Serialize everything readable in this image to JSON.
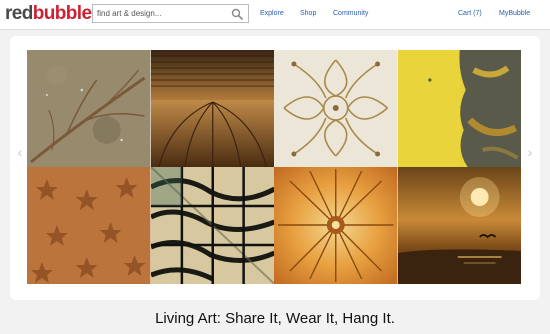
{
  "header": {
    "logo_part1": "red",
    "logo_part2": "bubble",
    "search_placeholder": "find art & design...",
    "nav": {
      "explore": "Explore",
      "shop": "Shop",
      "community": "Community",
      "cart": "Cart (7)",
      "my_bubble": "MyBubble"
    }
  },
  "slideshow": {
    "prev_icon": "chevron-left-icon",
    "next_icon": "chevron-right-icon",
    "artworks": [
      "leaf-skeleton-on-sand",
      "bronze-ribbed-metal",
      "kaleidoscope-pattern",
      "yellow-paint-texture",
      "starfish-pattern",
      "zebra-pattern-squares",
      "golden-fractal-burst",
      "sunset-seascape-with-bird"
    ]
  },
  "tagline": "Living Art: Share It, Wear It, Hang It.",
  "colors": {
    "brand_red": "#cc2233",
    "link_blue": "#2a5db0"
  }
}
